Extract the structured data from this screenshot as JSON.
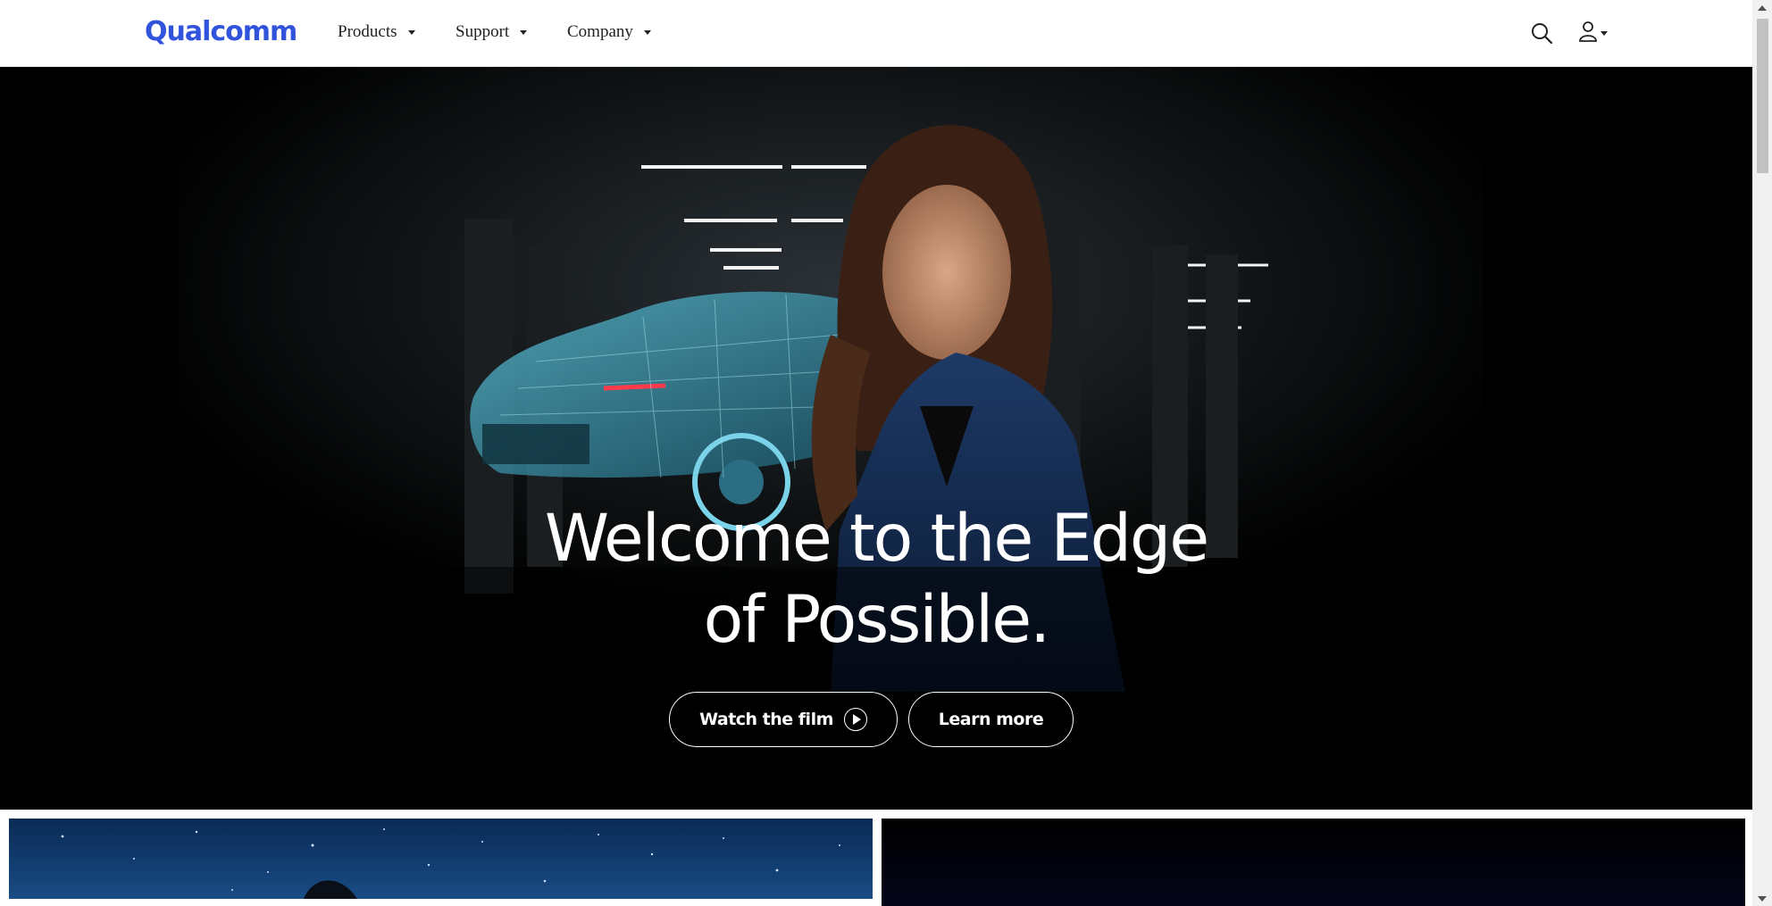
{
  "nav": {
    "logo": "Qualcomm",
    "items": [
      {
        "label": "Products"
      },
      {
        "label": "Support"
      },
      {
        "label": "Company"
      }
    ],
    "search_icon": "search-icon",
    "account_icon": "user-icon"
  },
  "hero": {
    "title_line1": "Welcome to the Edge",
    "title_line2": "of Possible.",
    "buttons": {
      "watch_label": "Watch the film",
      "learn_label": "Learn more"
    }
  },
  "colors": {
    "brand": "#3253dc",
    "hero_bg": "#000000",
    "nav_text": "#222222"
  }
}
